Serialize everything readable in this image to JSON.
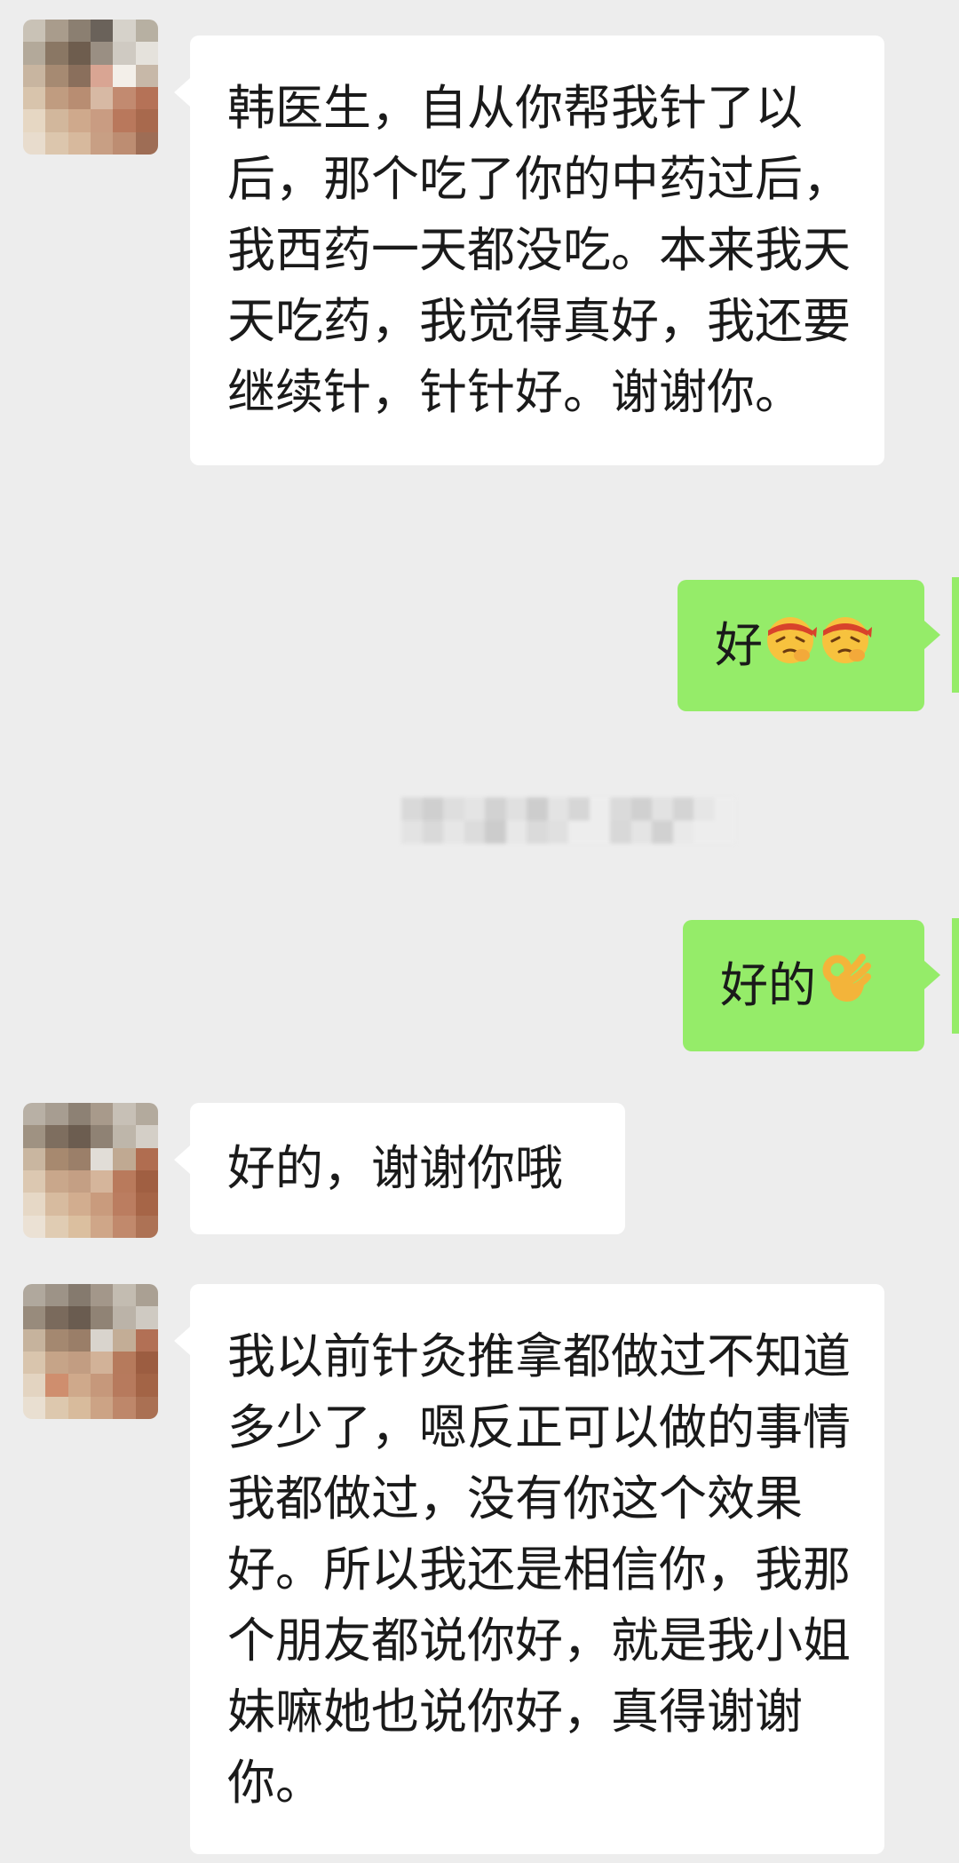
{
  "messages": [
    {
      "id": "m1",
      "side": "incoming",
      "text": "韩医生，自从你帮我针了以后，那个吃了你的中药过后，我西药一天都没吃。本来我天天吃药，我觉得真好，我还要继续针，针针好。谢谢你。"
    },
    {
      "id": "m2",
      "side": "outgoing",
      "text": "好",
      "emoji": [
        "shush-headband-face-icon",
        "shush-headband-face-icon"
      ]
    },
    {
      "id": "m3",
      "side": "outgoing",
      "text": "好的",
      "emoji": [
        "ok-hand-icon"
      ]
    },
    {
      "id": "m4",
      "side": "incoming",
      "text": "好的，谢谢你哦"
    },
    {
      "id": "m5",
      "side": "incoming",
      "text": "我以前针灸推拿都做过不知道多少了，嗯反正可以做的事情我都做过，没有你这个效果好。所以我还是相信你，我那个朋友都说你好，就是我小姐妹嘛她也说你好，真得谢谢你。"
    }
  ],
  "colors": {
    "background": "#ededed",
    "incoming_bubble": "#ffffff",
    "outgoing_bubble": "#95ec69"
  }
}
